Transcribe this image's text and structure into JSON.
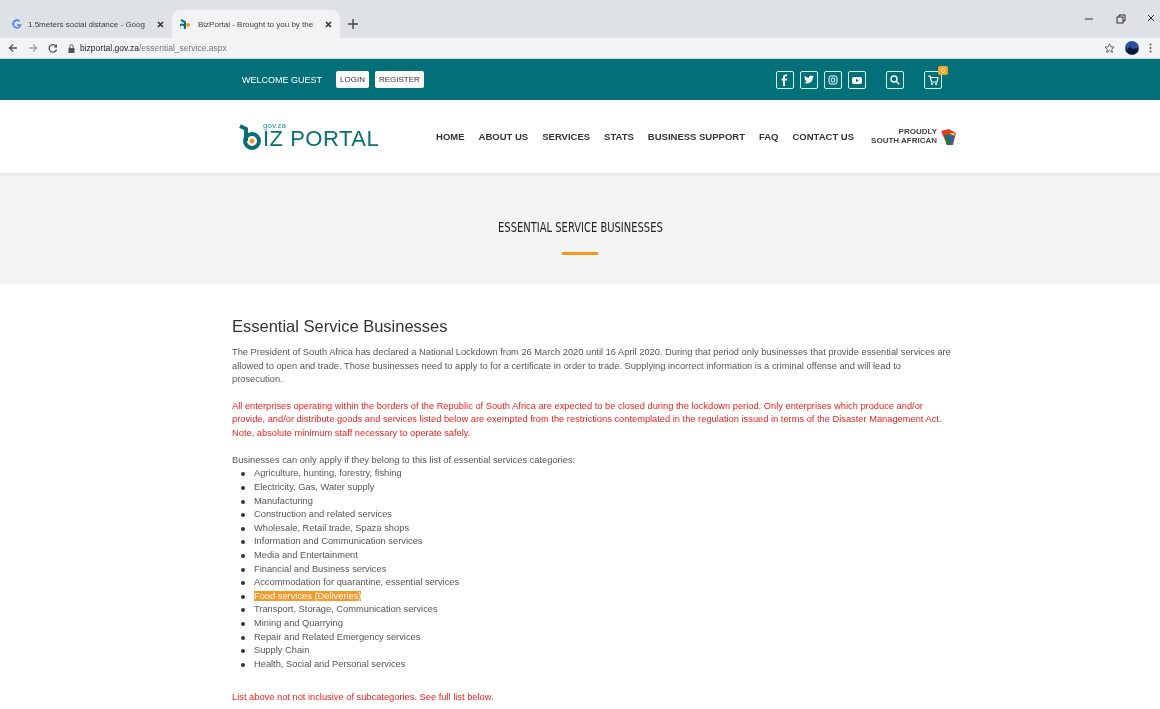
{
  "browser": {
    "tabs": [
      {
        "title": "1.5meters social distance - Goog",
        "selected": false
      },
      {
        "title": "BizPortal - Brought to you by the",
        "selected": true
      }
    ],
    "address": {
      "domain": "bizportal.gov.za",
      "path": "/essential_service.aspx"
    }
  },
  "topbar": {
    "welcome": "WELCOME GUEST",
    "buttons": [
      "LOGIN",
      "REGISTER"
    ],
    "cart_count": "0"
  },
  "header": {
    "logo": {
      "suffix": "gov.za",
      "text": "IZ PORTAL"
    },
    "nav": [
      "HOME",
      "ABOUT US",
      "SERVICES",
      "STATS",
      "BUSINESS SUPPORT",
      "FAQ",
      "CONTACT US"
    ],
    "badge": [
      "PROUDLY",
      "SOUTH AFRICAN"
    ]
  },
  "banner": {
    "title": "ESSENTIAL SERVICE BUSINESSES"
  },
  "content": {
    "heading": "Essential Service Businesses",
    "paragraphs": [
      {
        "kind": "normal",
        "text": "The President of South Africa has declared a National Lockdown from 26 March 2020 until 16 April 2020. During that period only businesses that provide essential services are allowed to open and trade. Those businesses need to apply to for a certificate in order to trade. Supplying incorrect information is a criminal offense and will lead to prosecution."
      },
      {
        "kind": "warning",
        "text": "All enterprises operating within the borders of the Republic of South Africa are expected to be closed during the lockdown period. Only enterprises which produce and/or provide, and/or distribute goods and services listed below are exempted from the restrictions contemplated in the regulation issued in terms of the Disaster Management Act. Note, absolute minimum staff necessary to operate safely."
      },
      {
        "kind": "normal",
        "text": "Businesses can only apply if they belong to this list of essential services categories:"
      }
    ],
    "categories": [
      {
        "label": "Agriculture, hunting, forestry, fishing",
        "highlighted": false
      },
      {
        "label": "Electricity, Gas, Water supply",
        "highlighted": false
      },
      {
        "label": "Manufacturing",
        "highlighted": false
      },
      {
        "label": "Construction and related services",
        "highlighted": false
      },
      {
        "label": "Wholesale, Retail trade, Spaza shops",
        "highlighted": false
      },
      {
        "label": "Information and Communication services",
        "highlighted": false
      },
      {
        "label": "Media and Entertainment",
        "highlighted": false
      },
      {
        "label": "Financial and Business services",
        "highlighted": false
      },
      {
        "label": "Accommodation for quarantine, essential services",
        "highlighted": false
      },
      {
        "label": "Food services (Deliveries)",
        "highlighted": true
      },
      {
        "label": "Transport, Storage, Communication services",
        "highlighted": false
      },
      {
        "label": "Mining and Quarrying",
        "highlighted": false
      },
      {
        "label": "Repair and Related Emergency services",
        "highlighted": false
      },
      {
        "label": "Supply Chain",
        "highlighted": false
      },
      {
        "label": "Health, Social and Personal services",
        "highlighted": false
      }
    ],
    "note": {
      "kind": "warning",
      "text": "List above not not inclusive of subcategories. See full list below."
    }
  }
}
